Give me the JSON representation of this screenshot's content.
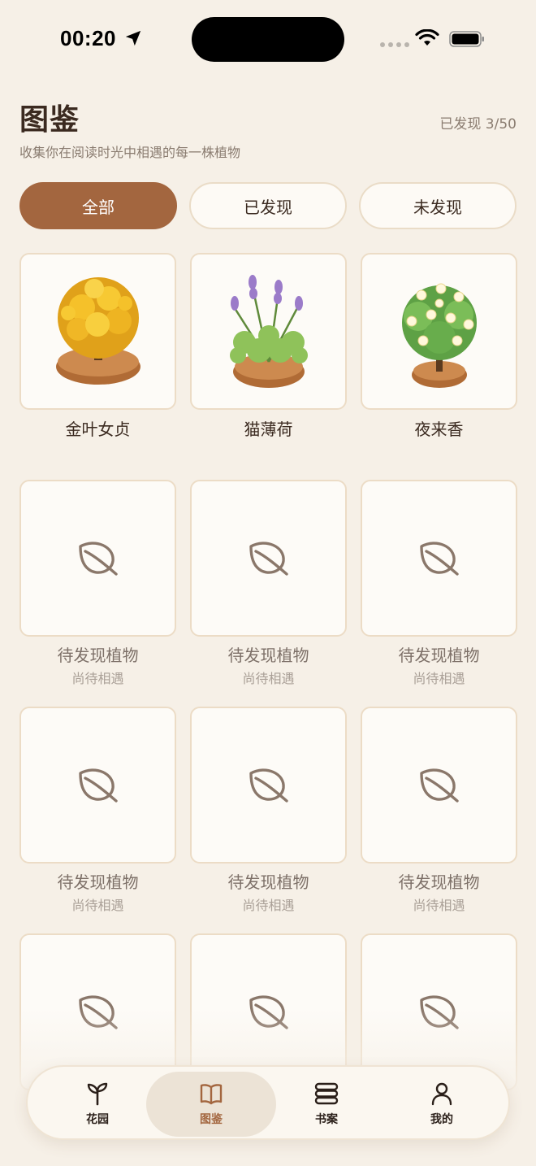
{
  "status_bar": {
    "time": "00:20"
  },
  "header": {
    "title": "图鉴",
    "subtitle": "收集你在阅读时光中相遇的每一株植物",
    "discovered_count": "已发现 3/50"
  },
  "filters": [
    {
      "label": "全部",
      "active": true
    },
    {
      "label": "已发现",
      "active": false
    },
    {
      "label": "未发现",
      "active": false
    }
  ],
  "discovered_plants": [
    {
      "name": "金叶女贞",
      "icon": "golden-privet-plant"
    },
    {
      "name": "猫薄荷",
      "icon": "catnip-plant"
    },
    {
      "name": "夜来香",
      "icon": "night-jasmine-plant"
    }
  ],
  "undiscovered_slot": {
    "title": "待发现植物",
    "subtitle": "尚待相遇",
    "icon": "leaf-icon"
  },
  "colors": {
    "background": "#f6f0e7",
    "accent": "#a3663f",
    "card_border": "#ecdcc6"
  },
  "tab_bar": [
    {
      "label": "花园",
      "icon": "sprout-icon",
      "selected": false
    },
    {
      "label": "图鉴",
      "icon": "book-icon",
      "selected": true
    },
    {
      "label": "书案",
      "icon": "stack-icon",
      "selected": false
    },
    {
      "label": "我的",
      "icon": "person-icon",
      "selected": false
    }
  ]
}
